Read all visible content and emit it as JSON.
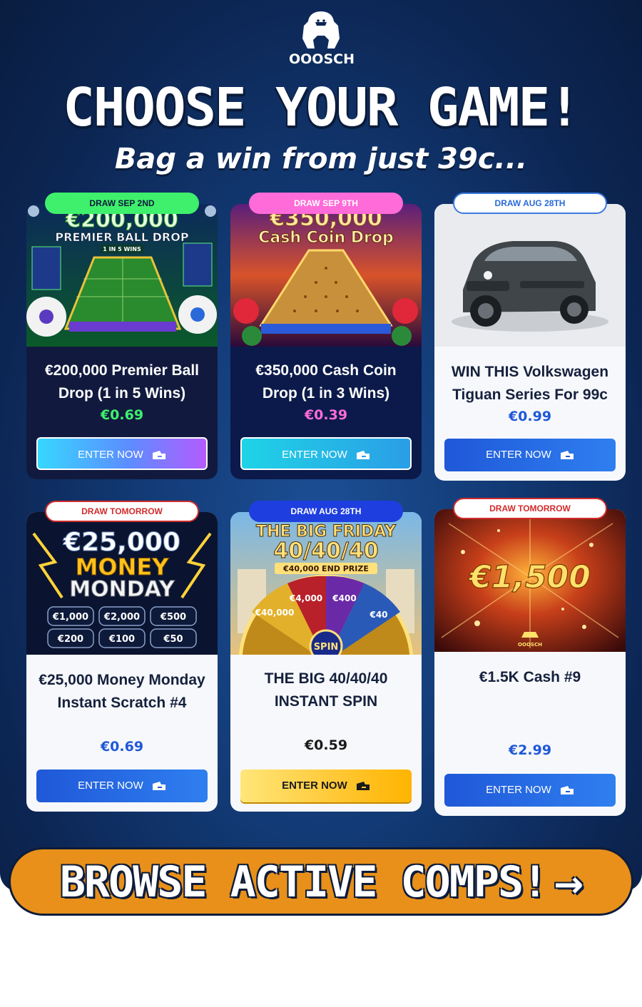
{
  "brand": {
    "logo_text": "OOOSCH"
  },
  "headline": "CHOOSE YOUR GAME!",
  "subhead": "Bag a win from just 39c...",
  "cards": [
    {
      "badge": "DRAW SEP 2ND",
      "image_text": {
        "amount": "€200,000",
        "name": "PREMIER BALL DROP",
        "odds": "1 IN 5 WINS"
      },
      "title": "€200,000 Premier Ball Drop (1 in 5 Wins)",
      "price": "€0.69",
      "price_color": "#3ff06c",
      "button": "ENTER NOW"
    },
    {
      "badge": "DRAW SEP 9TH",
      "image_text": {
        "amount": "€350,000",
        "name": "Cash Coin Drop"
      },
      "title": "€350,000 Cash Coin Drop (1 in 3 Wins)",
      "price": "€0.39",
      "price_color": "#ff6bd8",
      "button": "ENTER NOW"
    },
    {
      "badge": "DRAW AUG 28TH",
      "title": "WIN THIS Volkswagen Tiguan Series For 99c",
      "price": "€0.99",
      "price_color": "#1f58d8",
      "button": "ENTER NOW"
    },
    {
      "badge": "DRAW TOMORROW",
      "image_text": {
        "amount": "€25,000",
        "line2": "MONEY",
        "line3": "MONDAY",
        "prizes": [
          "€1,000",
          "€2,000",
          "€500",
          "€200",
          "€100",
          "€50"
        ]
      },
      "title": "€25,000 Money Monday Instant Scratch #4",
      "price": "€0.69",
      "price_color": "#1f58d8",
      "button": "ENTER NOW"
    },
    {
      "badge": "DRAW AUG 28TH",
      "image_text": {
        "line1": "THE BIG FRIDAY",
        "line2": "40/40/40",
        "line3": "€40,000 END PRIZE",
        "wheel": [
          "€40,000",
          "€4,000",
          "€400",
          "€40"
        ],
        "spin": "SPIN"
      },
      "title": "THE BIG 40/40/40 INSTANT SPIN",
      "price": "€0.59",
      "price_color": "#1a1a1a",
      "button": "ENTER NOW"
    },
    {
      "badge": "DRAW TOMORROW",
      "image_text": {
        "amount": "€1,500",
        "logo": "OOOSCH"
      },
      "title": "€1.5K Cash #9",
      "price": "€2.99",
      "price_color": "#1f58d8",
      "button": "ENTER NOW"
    }
  ],
  "browse": {
    "label": "BROWSE ACTIVE COMPS!",
    "arrow": "→"
  }
}
